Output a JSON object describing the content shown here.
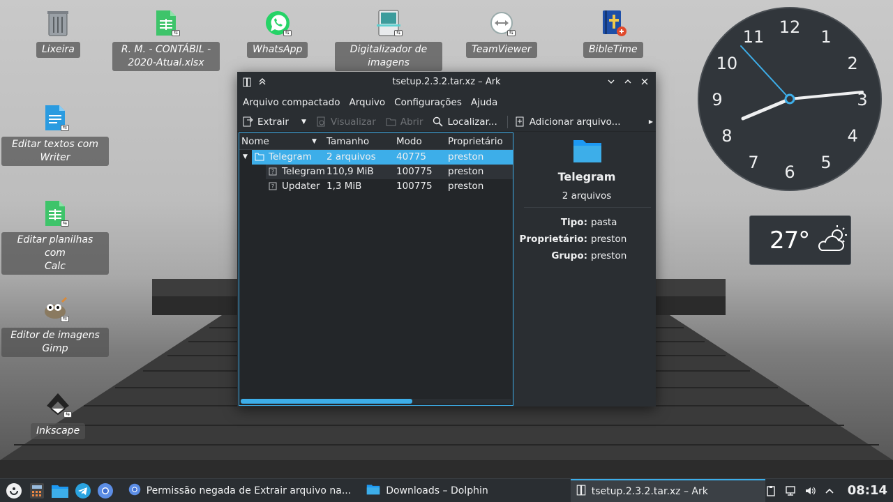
{
  "desktop_icons": [
    {
      "id": "lixeira",
      "label": "Lixeira",
      "icon": "trash-icon"
    },
    {
      "id": "planilha",
      "label": "R. M. - CONTÁBIL -\n2020-Atual.xlsx",
      "icon": "spreadsheet-icon"
    },
    {
      "id": "whatsapp",
      "label": "WhatsApp",
      "icon": "whatsapp-icon"
    },
    {
      "id": "digitalizador",
      "label": "Digitalizador de\nimagens",
      "icon": "scanner-icon"
    },
    {
      "id": "teamviewer",
      "label": "TeamViewer",
      "icon": "teamviewer-icon"
    },
    {
      "id": "bibletime",
      "label": "BibleTime",
      "icon": "bible-icon"
    },
    {
      "id": "writer",
      "label": "Editar textos com\nWriter",
      "icon": "document-icon"
    },
    {
      "id": "calc",
      "label": "Editar planilhas com\nCalc",
      "icon": "spreadsheet-icon"
    },
    {
      "id": "gimp",
      "label": "Editor de imagens\nGimp",
      "icon": "gimp-icon"
    },
    {
      "id": "inkscape",
      "label": "Inkscape",
      "icon": "inkscape-icon"
    }
  ],
  "clock": {
    "numbers": [
      "12",
      "1",
      "2",
      "3",
      "4",
      "5",
      "6",
      "7",
      "8",
      "9",
      "10",
      "11"
    ]
  },
  "weather": {
    "temperature": "27°",
    "icon": "partly-cloudy-icon"
  },
  "ark": {
    "title": "tsetup.2.3.2.tar.xz – Ark",
    "menu": [
      "Arquivo compactado",
      "Arquivo",
      "Configurações",
      "Ajuda"
    ],
    "toolbar": {
      "extract": "Extrair",
      "preview": "Visualizar",
      "open": "Abrir",
      "find": "Localizar...",
      "add_file": "Adicionar arquivo..."
    },
    "columns": [
      "Nome",
      "Tamanho",
      "Modo",
      "Proprietário"
    ],
    "rows": [
      {
        "name": "Telegram",
        "size": "2 arquivos",
        "mode": "40775",
        "owner": "preston"
      },
      {
        "name": "Telegram",
        "size": "110,9 MiB",
        "mode": "100775",
        "owner": "preston"
      },
      {
        "name": "Updater",
        "size": "1,3 MiB",
        "mode": "100775",
        "owner": "preston"
      }
    ],
    "info": {
      "name": "Telegram",
      "subtitle": "2 arquivos",
      "type_label": "Tipo:",
      "type_value": "pasta",
      "owner_label": "Proprietário:",
      "owner_value": "preston",
      "group_label": "Grupo:",
      "group_value": "preston"
    }
  },
  "taskbar": {
    "tasks": [
      {
        "label": "Permissão negada de Extrair arquivo na...",
        "active": false
      },
      {
        "label": "Downloads – Dolphin",
        "active": false
      },
      {
        "label": "tsetup.2.3.2.tar.xz – Ark",
        "active": true
      }
    ],
    "time": "08:14"
  },
  "colors": {
    "accent": "#3daee9",
    "panel": "#2a2e32",
    "view": "#232629",
    "text": "#eff0f1"
  }
}
